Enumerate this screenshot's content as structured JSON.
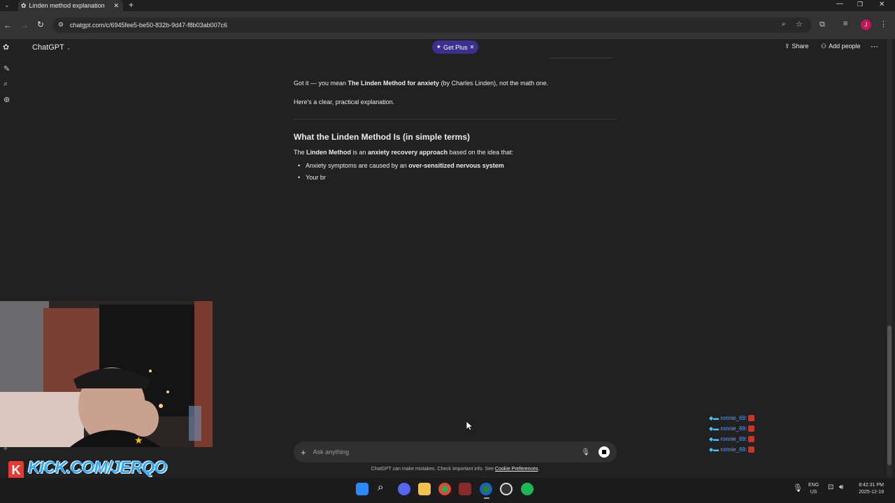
{
  "browser": {
    "tab_title": "Linden method explanation",
    "url": "chatgpt.com/c/6945fee5-be50-832b-9d47-f8b03ab007c6"
  },
  "header": {
    "app_name": "ChatGPT",
    "get_plus_label": "Get Plus",
    "share_label": "Share",
    "add_people_label": "Add people"
  },
  "message": {
    "p1_pre": "Got it — you mean ",
    "p1_bold": "The Linden Method for anxiety",
    "p1_post": " (by Charles Linden), not the math one.",
    "p2": "Here's a clear, practical explanation.",
    "heading": "What the Linden Method Is (in simple terms)",
    "p3_pre": "The ",
    "p3_bold1": "Linden Method",
    "p3_mid": " is an ",
    "p3_bold2": "anxiety recovery approach",
    "p3_post": " based on the idea that:",
    "bullet1_pre": "Anxiety symptoms are caused by an ",
    "bullet1_bold": "over-sensitized nervous system",
    "bullet2": "Your br"
  },
  "composer": {
    "placeholder": "Ask anything",
    "disclaimer": "ChatGPT can make mistakes. Check important info. See ",
    "disclaimer_link": "Cookie Preferences",
    "disclaimer_end": "."
  },
  "stream_chat": {
    "username": "ronnie_69",
    "count": 4
  },
  "overlay": {
    "kick_text": "KICK.COM/JERQO"
  },
  "taskbar": {
    "lang_top": "ENG",
    "lang_bottom": "US",
    "time": "8:42:31 PM",
    "date": "2025-12-19"
  },
  "colors": {
    "accent_purple": "#3b2f8f",
    "kick_green": "#53fc18",
    "link_blue": "#5aa0ff"
  }
}
